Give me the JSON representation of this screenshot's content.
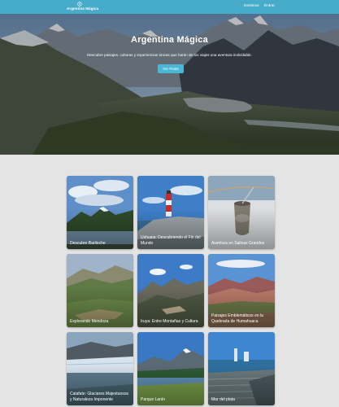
{
  "navbar": {
    "brand_name": "Argentina Mágica",
    "links": [
      {
        "label": "Destinos"
      },
      {
        "label": "Entrar"
      }
    ]
  },
  "hero": {
    "title": "Argentina Mágica",
    "subtitle": "Descubre paisajes, culturas y experiencias únicas que harán de tus viajes una aventura inolvidable.",
    "button_label": "Ver Posts"
  },
  "destinations": [
    {
      "label": "Descubre Bariloche"
    },
    {
      "label": "Ushuaia: Descubriendo el Fin del Mundo"
    },
    {
      "label": "Aventura en Salinas Grandes"
    },
    {
      "label": "Explorando Mendoza"
    },
    {
      "label": "Iruya: Entre Montañas y Cultura"
    },
    {
      "label": "Paisajes Emblemáticos en la Quebrada de Humahuaca"
    },
    {
      "label": "Calafate: Glaciares Majestuosos y Naturaleza Imponente"
    },
    {
      "label": "Parque Lanín"
    },
    {
      "label": "Mar del plata"
    }
  ],
  "colors": {
    "navbar": "#47acc9",
    "button": "#4ab7d6",
    "page_background": "#e4e4e4"
  }
}
